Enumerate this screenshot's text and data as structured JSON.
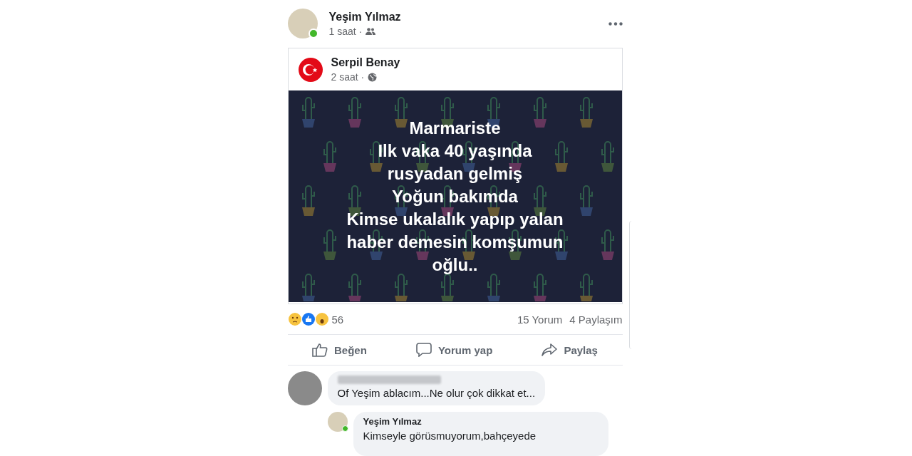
{
  "post": {
    "author": "Yeşim Yılmaz",
    "online": true,
    "time": "1 saat ·",
    "shared": {
      "author": "Serpil Benay",
      "time": "2 saat ·",
      "image_lines": [
        "Marmariste",
        "Ilk vaka 40 yaşında",
        "rusyadan gelmiş",
        "Yoğun bakımda",
        "Kimse ukalalık yapıp yalan",
        "haber demesin komşumun",
        "oğlu.."
      ]
    },
    "reactions": {
      "count": "56",
      "comments": "15 Yorum",
      "shares": "4 Paylaşım"
    },
    "actions": [
      {
        "kind": "like",
        "label": "Beğen"
      },
      {
        "kind": "comment",
        "label": "Yorum yap"
      },
      {
        "kind": "share",
        "label": "Paylaş"
      }
    ],
    "comments": [
      {
        "text": "Of Yeşim ablacım...Ne olur çok dikkat et...",
        "name_blurred": true,
        "reply": false,
        "online": false
      },
      {
        "author": "Yeşim Yılmaz",
        "text": "Kimseyle görüsmuyorum,bahçeyede",
        "name_blurred": false,
        "reply": true,
        "online": true
      }
    ]
  }
}
